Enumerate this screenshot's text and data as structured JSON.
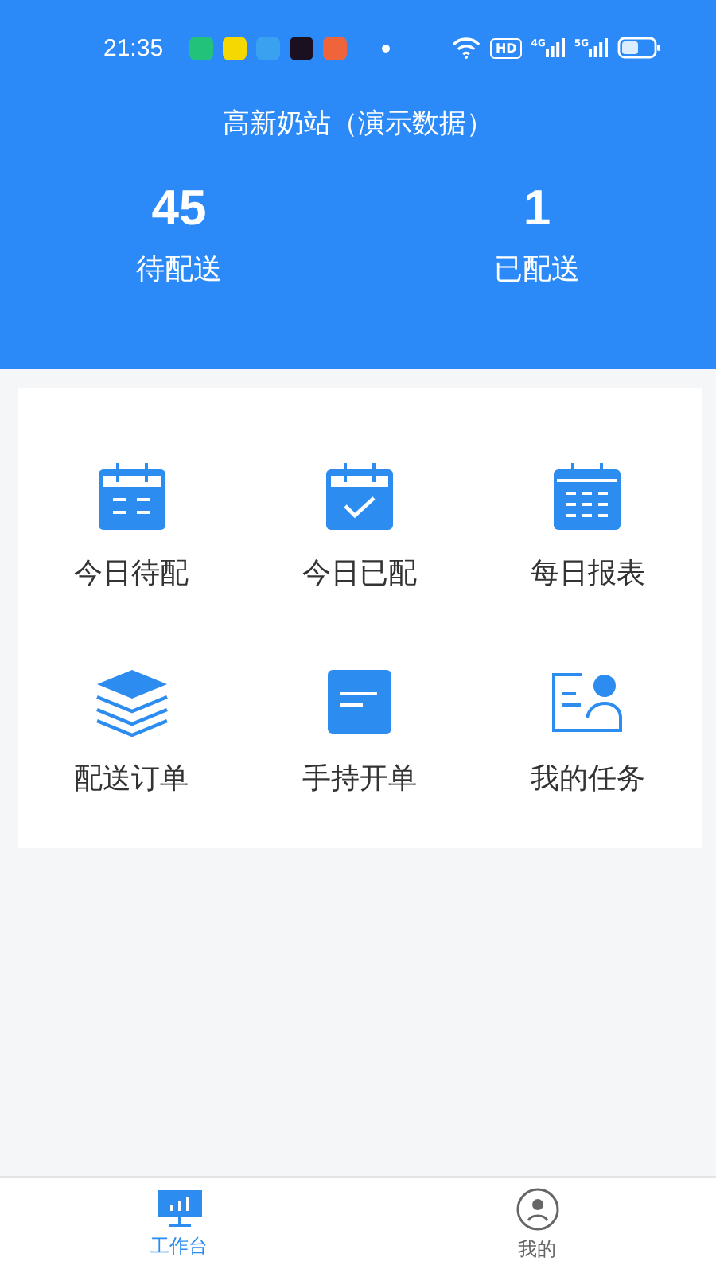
{
  "status_bar": {
    "time": "21:35",
    "apps": [
      {
        "color": "#22c27a"
      },
      {
        "color": "#f5d800"
      },
      {
        "color": "#3aa0f0"
      },
      {
        "color": "#1a1020"
      },
      {
        "color": "#f0643c"
      }
    ],
    "hd": "HD",
    "signals": [
      {
        "label": "4G"
      },
      {
        "label": "5G"
      }
    ]
  },
  "header": {
    "title": "高新奶站（演示数据）",
    "stats": [
      {
        "value": "45",
        "label": "待配送"
      },
      {
        "value": "1",
        "label": "已配送"
      }
    ]
  },
  "menu": [
    {
      "kind": "calendar-list",
      "label": "今日待配"
    },
    {
      "kind": "calendar-check",
      "label": "今日已配"
    },
    {
      "kind": "calendar-grid",
      "label": "每日报表"
    },
    {
      "kind": "layers",
      "label": "配送订单"
    },
    {
      "kind": "note",
      "label": "手持开单"
    },
    {
      "kind": "person-card",
      "label": "我的任务"
    }
  ],
  "tabs": [
    {
      "kind": "monitor",
      "label": "工作台",
      "selected": true
    },
    {
      "kind": "person",
      "label": "我的",
      "selected": false
    }
  ]
}
